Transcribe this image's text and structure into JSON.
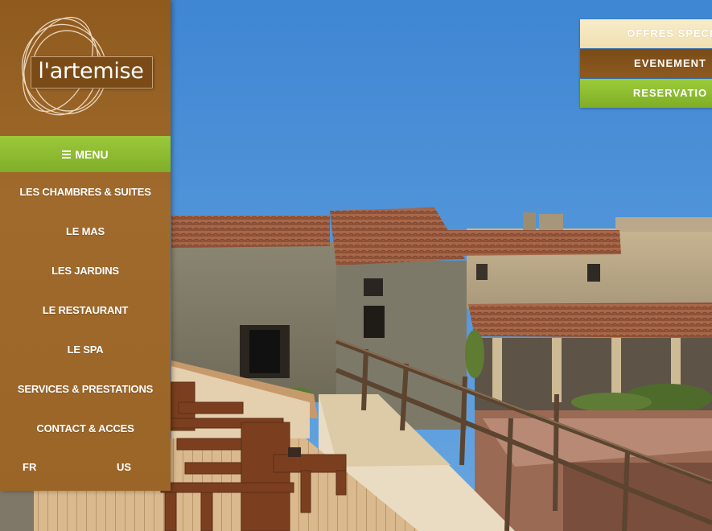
{
  "brand": {
    "name": "l'artemise"
  },
  "menu": {
    "toggle_label": "MENU"
  },
  "nav": {
    "items": [
      "LES CHAMBRES & SUITES",
      "LE MAS",
      "LES JARDINS",
      "LE RESTAURANT",
      "LE SPA",
      "SERVICES & PRESTATIONS",
      "CONTACT & ACCES"
    ]
  },
  "languages": {
    "fr": "FR",
    "us": "US"
  },
  "actions": {
    "offres": "OFFRES SPECI",
    "evenements": "EVENEMENT",
    "reservation": "RESERVATIO"
  },
  "colors": {
    "sidebar_brown": "#9b6528",
    "menu_green": "#8cbc31",
    "events_brown": "#845320",
    "offres_cream": "#f4e6bd",
    "sky_blue": "#4f8fd0"
  }
}
